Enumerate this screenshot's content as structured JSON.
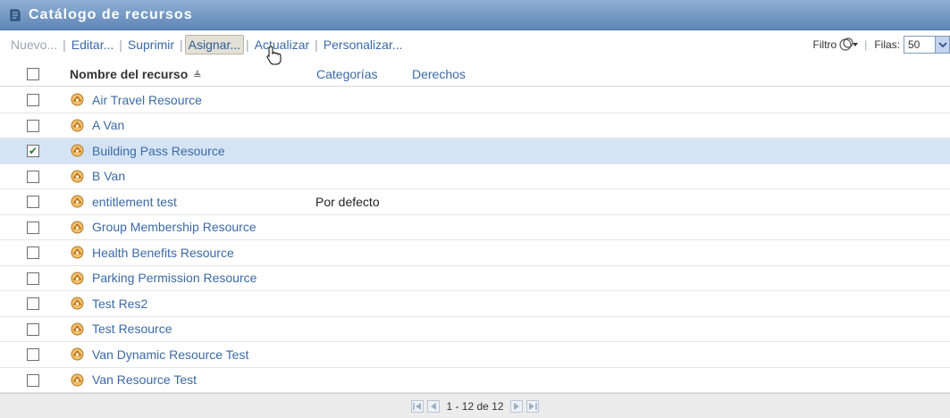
{
  "window": {
    "title": "Catálogo de recursos"
  },
  "toolbar": {
    "new_label": "Nuevo...",
    "edit_label": "Editar...",
    "delete_label": "Suprimir",
    "assign_label": "Asignar...",
    "refresh_label": "Actualizar",
    "customize_label": "Personalizar..."
  },
  "filter": {
    "label": "Filtro",
    "rows_label": "Filas:",
    "rows_value": "50"
  },
  "table": {
    "headers": {
      "name": "Nombre del recurso",
      "categories": "Categorías",
      "rights": "Derechos"
    },
    "rows": [
      {
        "name": "Air Travel Resource",
        "category": "",
        "checked": false
      },
      {
        "name": "A Van",
        "category": "",
        "checked": false
      },
      {
        "name": "Building Pass Resource",
        "category": "",
        "checked": true
      },
      {
        "name": "B Van",
        "category": "",
        "checked": false
      },
      {
        "name": "entitlement test",
        "category": "Por defecto",
        "checked": false
      },
      {
        "name": "Group Membership Resource",
        "category": "",
        "checked": false
      },
      {
        "name": "Health Benefits Resource",
        "category": "",
        "checked": false
      },
      {
        "name": "Parking Permission Resource",
        "category": "",
        "checked": false
      },
      {
        "name": "Test Res2",
        "category": "",
        "checked": false
      },
      {
        "name": "Test Resource",
        "category": "",
        "checked": false
      },
      {
        "name": "Van Dynamic Resource Test",
        "category": "",
        "checked": false
      },
      {
        "name": "Van Resource Test",
        "category": "",
        "checked": false
      }
    ]
  },
  "pagination": {
    "text": "1 - 12 de 12"
  },
  "colors": {
    "title_bar": "#6f93c4",
    "link": "#3b6aa5",
    "selected_row": "#d5e4f5"
  }
}
